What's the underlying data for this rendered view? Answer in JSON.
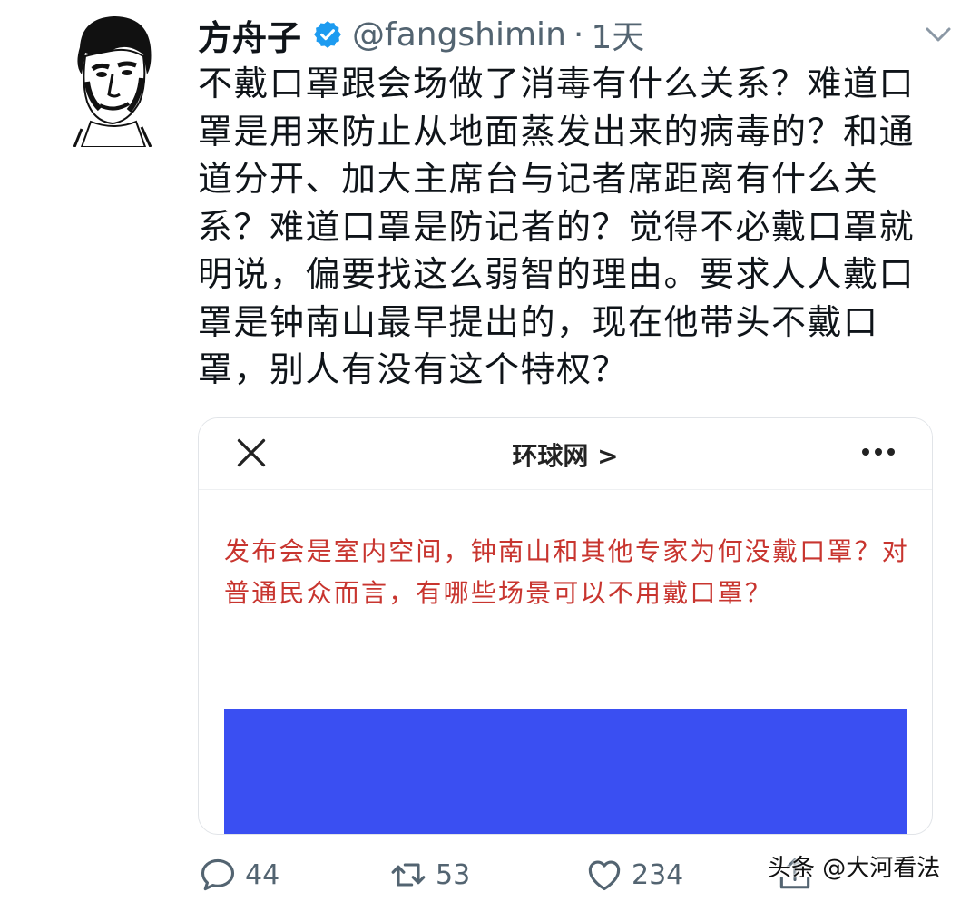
{
  "tweet": {
    "author_name": "方舟子",
    "handle": "@fangshimin",
    "separator": "·",
    "time": "1天",
    "text": "不戴口罩跟会场做了消毒有什么关系？难道口罩是用来防止从地面蒸发出来的病毒的？和通道分开、加大主席台与记者席距离有什么关系？难道口罩是防记者的？觉得不必戴口罩就明说，偏要找这么弱智的理由。要求人人戴口罩是钟南山最早提出的，现在他带头不戴口罩，别人有没有这个特权？"
  },
  "card": {
    "title": "环球网 >",
    "question": "发布会是室内空间，钟南山和其他专家为何没戴口罩？对普通民众而言，有哪些场景可以不用戴口罩？",
    "image_color": "#3a4ff2"
  },
  "actions": {
    "replies": "44",
    "retweets": "53",
    "likes": "234"
  },
  "watermark": "头条 @大河看法",
  "colors": {
    "verified": "#1d9bf0",
    "question_text": "#c8352f",
    "muted": "#536471"
  }
}
